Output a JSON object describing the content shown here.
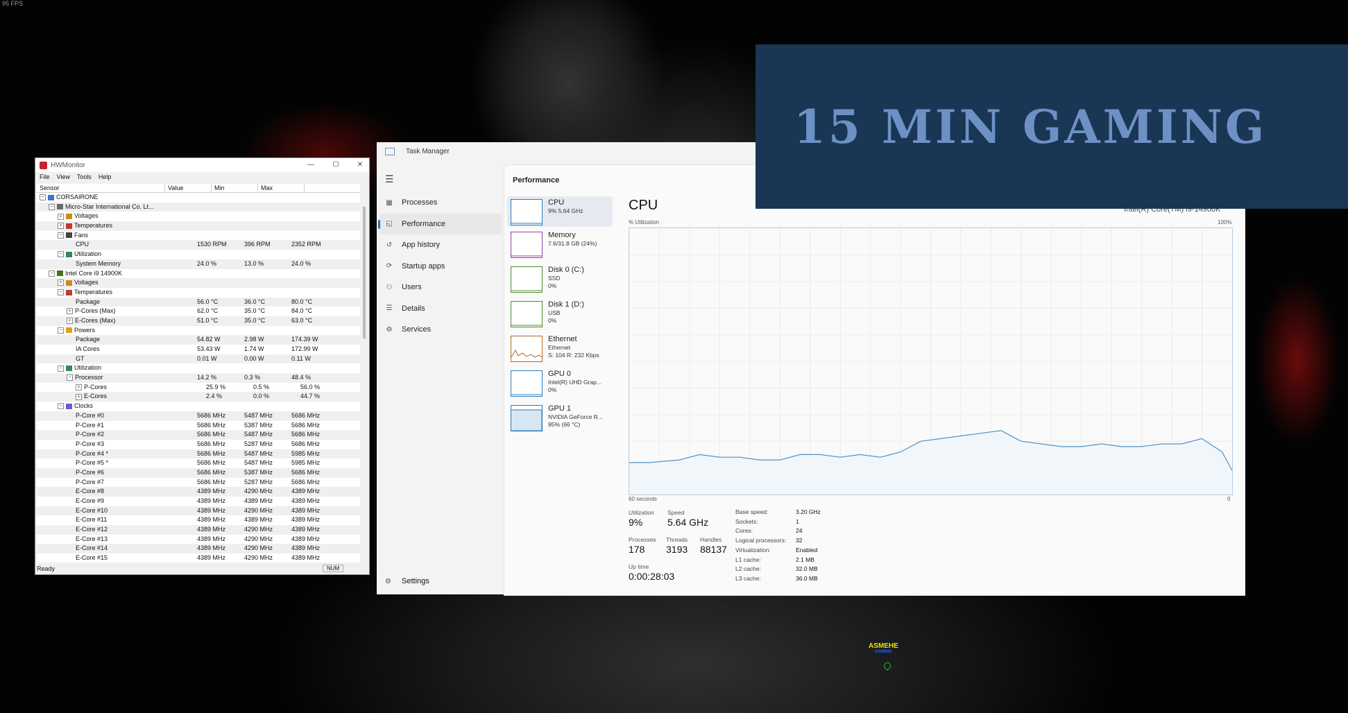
{
  "overlay": {
    "fps": "95 FPS",
    "banner": "15 MIN GAMING",
    "watermark_name": "ASMEHE",
    "watermark_sub": "GAMING"
  },
  "hwmonitor": {
    "title": "HWMonitor",
    "menu": [
      "File",
      "View",
      "Tools",
      "Help"
    ],
    "columns": [
      "Sensor",
      "Value",
      "Min",
      "Max"
    ],
    "status": "Ready",
    "num_indicator": "NUM",
    "rows": [
      {
        "indent": 0,
        "toggle": "−",
        "icon": "computer",
        "name": "CORSAIRONE",
        "value": "",
        "min": "",
        "max": ""
      },
      {
        "indent": 1,
        "toggle": "−",
        "icon": "board",
        "name": "Micro-Star International Co. Lt...",
        "value": "",
        "min": "",
        "max": ""
      },
      {
        "indent": 2,
        "toggle": "+",
        "icon": "voltage",
        "name": "Voltages",
        "value": "",
        "min": "",
        "max": ""
      },
      {
        "indent": 2,
        "toggle": "+",
        "icon": "temp",
        "name": "Temperatures",
        "value": "",
        "min": "",
        "max": ""
      },
      {
        "indent": 2,
        "toggle": "−",
        "icon": "fan",
        "name": "Fans",
        "value": "",
        "min": "",
        "max": ""
      },
      {
        "indent": 3,
        "toggle": "",
        "icon": "",
        "name": "CPU",
        "value": "1530 RPM",
        "min": "396 RPM",
        "max": "2352 RPM"
      },
      {
        "indent": 2,
        "toggle": "−",
        "icon": "util",
        "name": "Utilization",
        "value": "",
        "min": "",
        "max": ""
      },
      {
        "indent": 3,
        "toggle": "",
        "icon": "",
        "name": "System Memory",
        "value": "24.0 %",
        "min": "13.0 %",
        "max": "24.0 %"
      },
      {
        "indent": 1,
        "toggle": "−",
        "icon": "chip",
        "name": "Intel Core i9 14900K",
        "value": "",
        "min": "",
        "max": ""
      },
      {
        "indent": 2,
        "toggle": "+",
        "icon": "voltage",
        "name": "Voltages",
        "value": "",
        "min": "",
        "max": ""
      },
      {
        "indent": 2,
        "toggle": "−",
        "icon": "temp",
        "name": "Temperatures",
        "value": "",
        "min": "",
        "max": ""
      },
      {
        "indent": 3,
        "toggle": "",
        "icon": "",
        "name": "Package",
        "value": "56.0 °C",
        "min": "36.0 °C",
        "max": "80.0 °C"
      },
      {
        "indent": 3,
        "toggle": "+",
        "icon": "",
        "name": "P-Cores (Max)",
        "value": "62.0 °C",
        "min": "35.0 °C",
        "max": "84.0 °C"
      },
      {
        "indent": 3,
        "toggle": "+",
        "icon": "",
        "name": "E-Cores (Max)",
        "value": "51.0 °C",
        "min": "35.0 °C",
        "max": "63.0 °C"
      },
      {
        "indent": 2,
        "toggle": "−",
        "icon": "power",
        "name": "Powers",
        "value": "",
        "min": "",
        "max": ""
      },
      {
        "indent": 3,
        "toggle": "",
        "icon": "",
        "name": "Package",
        "value": "54.82 W",
        "min": "2.98 W",
        "max": "174.39 W"
      },
      {
        "indent": 3,
        "toggle": "",
        "icon": "",
        "name": "IA Cores",
        "value": "53.43 W",
        "min": "1.74 W",
        "max": "172.99 W"
      },
      {
        "indent": 3,
        "toggle": "",
        "icon": "",
        "name": "GT",
        "value": "0.01 W",
        "min": "0.00 W",
        "max": "0.11 W"
      },
      {
        "indent": 2,
        "toggle": "−",
        "icon": "util",
        "name": "Utilization",
        "value": "",
        "min": "",
        "max": ""
      },
      {
        "indent": 3,
        "toggle": "−",
        "icon": "",
        "name": "Processor",
        "value": "14.2 %",
        "min": "0.3 %",
        "max": "48.4 %"
      },
      {
        "indent": 4,
        "toggle": "+",
        "icon": "",
        "name": "P-Cores",
        "value": "25.9 %",
        "min": "0.5 %",
        "max": "56.0 %"
      },
      {
        "indent": 4,
        "toggle": "+",
        "icon": "",
        "name": "E-Cores",
        "value": "2.4 %",
        "min": "0.0 %",
        "max": "44.7 %"
      },
      {
        "indent": 2,
        "toggle": "−",
        "icon": "clock",
        "name": "Clocks",
        "value": "",
        "min": "",
        "max": ""
      },
      {
        "indent": 3,
        "toggle": "",
        "icon": "",
        "name": "P-Core #0",
        "value": "5686 MHz",
        "min": "5487 MHz",
        "max": "5686 MHz"
      },
      {
        "indent": 3,
        "toggle": "",
        "icon": "",
        "name": "P-Core #1",
        "value": "5686 MHz",
        "min": "5387 MHz",
        "max": "5686 MHz"
      },
      {
        "indent": 3,
        "toggle": "",
        "icon": "",
        "name": "P-Core #2",
        "value": "5686 MHz",
        "min": "5487 MHz",
        "max": "5686 MHz"
      },
      {
        "indent": 3,
        "toggle": "",
        "icon": "",
        "name": "P-Core #3",
        "value": "5686 MHz",
        "min": "5287 MHz",
        "max": "5686 MHz"
      },
      {
        "indent": 3,
        "toggle": "",
        "icon": "",
        "name": "P-Core #4 *",
        "value": "5686 MHz",
        "min": "5487 MHz",
        "max": "5985 MHz"
      },
      {
        "indent": 3,
        "toggle": "",
        "icon": "",
        "name": "P-Core #5 *",
        "value": "5686 MHz",
        "min": "5487 MHz",
        "max": "5985 MHz"
      },
      {
        "indent": 3,
        "toggle": "",
        "icon": "",
        "name": "P-Core #6",
        "value": "5686 MHz",
        "min": "5387 MHz",
        "max": "5686 MHz"
      },
      {
        "indent": 3,
        "toggle": "",
        "icon": "",
        "name": "P-Core #7",
        "value": "5686 MHz",
        "min": "5287 MHz",
        "max": "5686 MHz"
      },
      {
        "indent": 3,
        "toggle": "",
        "icon": "",
        "name": "E-Core #8",
        "value": "4389 MHz",
        "min": "4290 MHz",
        "max": "4389 MHz"
      },
      {
        "indent": 3,
        "toggle": "",
        "icon": "",
        "name": "E-Core #9",
        "value": "4389 MHz",
        "min": "4389 MHz",
        "max": "4389 MHz"
      },
      {
        "indent": 3,
        "toggle": "",
        "icon": "",
        "name": "E-Core #10",
        "value": "4389 MHz",
        "min": "4290 MHz",
        "max": "4389 MHz"
      },
      {
        "indent": 3,
        "toggle": "",
        "icon": "",
        "name": "E-Core #11",
        "value": "4389 MHz",
        "min": "4389 MHz",
        "max": "4389 MHz"
      },
      {
        "indent": 3,
        "toggle": "",
        "icon": "",
        "name": "E-Core #12",
        "value": "4389 MHz",
        "min": "4290 MHz",
        "max": "4389 MHz"
      },
      {
        "indent": 3,
        "toggle": "",
        "icon": "",
        "name": "E-Core #13",
        "value": "4389 MHz",
        "min": "4290 MHz",
        "max": "4389 MHz"
      },
      {
        "indent": 3,
        "toggle": "",
        "icon": "",
        "name": "E-Core #14",
        "value": "4389 MHz",
        "min": "4290 MHz",
        "max": "4389 MHz"
      },
      {
        "indent": 3,
        "toggle": "",
        "icon": "",
        "name": "E-Core #15",
        "value": "4389 MHz",
        "min": "4290 MHz",
        "max": "4389 MHz"
      }
    ]
  },
  "taskmanager": {
    "title": "Task Manager",
    "nav": [
      {
        "label": "Processes",
        "icon": "processes-icon",
        "glyph": "▦"
      },
      {
        "label": "Performance",
        "icon": "performance-icon",
        "glyph": "◱",
        "selected": true
      },
      {
        "label": "App history",
        "icon": "history-icon",
        "glyph": "↺"
      },
      {
        "label": "Startup apps",
        "icon": "startup-icon",
        "glyph": "⟳"
      },
      {
        "label": "Users",
        "icon": "users-icon",
        "glyph": "⚇"
      },
      {
        "label": "Details",
        "icon": "details-icon",
        "glyph": "☰"
      },
      {
        "label": "Services",
        "icon": "services-icon",
        "glyph": "⚙"
      }
    ],
    "settings_label": "Settings",
    "page_title": "Performance",
    "devices": [
      {
        "name": "CPU",
        "line1": "9%  5.64 GHz",
        "line2": "",
        "selected": true,
        "color": "#2a7ab8"
      },
      {
        "name": "Memory",
        "line1": "7.6/31.8 GB (24%)",
        "line2": "",
        "color": "#8e3fa5"
      },
      {
        "name": "Disk 0 (C:)",
        "line1": "SSD",
        "line2": "0%",
        "color": "#4b8a2e"
      },
      {
        "name": "Disk 1 (D:)",
        "line1": "USB",
        "line2": "0%",
        "color": "#4b8a2e"
      },
      {
        "name": "Ethernet",
        "line1": "Ethernet",
        "line2": "S: 104  R: 232 Kbps",
        "color": "#b46a1f"
      },
      {
        "name": "GPU 0",
        "line1": "Intel(R) UHD Grap...",
        "line2": "0%",
        "color": "#2a7ab8"
      },
      {
        "name": "GPU 1",
        "line1": "NVIDIA GeForce R...",
        "line2": "95%  (66 °C)",
        "color": "#2a7ab8"
      }
    ],
    "cpu": {
      "heading": "CPU",
      "model": "Intel(R) Core(TM) i9-14900K",
      "util_label": "% Utilization",
      "util_max": "100%",
      "time_left": "60 seconds",
      "time_right": "0",
      "stats": {
        "utilization_label": "Utilization",
        "utilization": "9%",
        "speed_label": "Speed",
        "speed": "5.64 GHz",
        "processes_label": "Processes",
        "processes": "178",
        "threads_label": "Threads",
        "threads": "3193",
        "handles_label": "Handles",
        "handles": "88137",
        "uptime_label": "Up time",
        "uptime": "0:00:28:03"
      },
      "specs": [
        {
          "k": "Base speed:",
          "v": "3.20 GHz"
        },
        {
          "k": "Sockets:",
          "v": "1"
        },
        {
          "k": "Cores:",
          "v": "24"
        },
        {
          "k": "Logical processors:",
          "v": "32"
        },
        {
          "k": "Virtualization:",
          "v": "Enabled"
        },
        {
          "k": "L1 cache:",
          "v": "2.1 MB"
        },
        {
          "k": "L2 cache:",
          "v": "32.0 MB"
        },
        {
          "k": "L3 cache:",
          "v": "36.0 MB"
        }
      ],
      "chart_data": {
        "type": "area",
        "ylim": [
          0,
          100
        ],
        "xlim": [
          -60,
          0
        ],
        "x": [
          -60,
          -58,
          -55,
          -53,
          -51,
          -49,
          -47,
          -45,
          -43,
          -41,
          -39,
          -37,
          -35,
          -33,
          -31,
          -29,
          -27,
          -25,
          -23,
          -21,
          -19,
          -17,
          -15,
          -13,
          -11,
          -9,
          -7,
          -5,
          -3,
          -1,
          0
        ],
        "values": [
          12,
          12,
          13,
          15,
          14,
          14,
          13,
          13,
          15,
          15,
          14,
          15,
          14,
          16,
          20,
          21,
          22,
          23,
          24,
          20,
          19,
          18,
          18,
          19,
          18,
          18,
          19,
          19,
          21,
          16,
          9
        ]
      }
    }
  }
}
